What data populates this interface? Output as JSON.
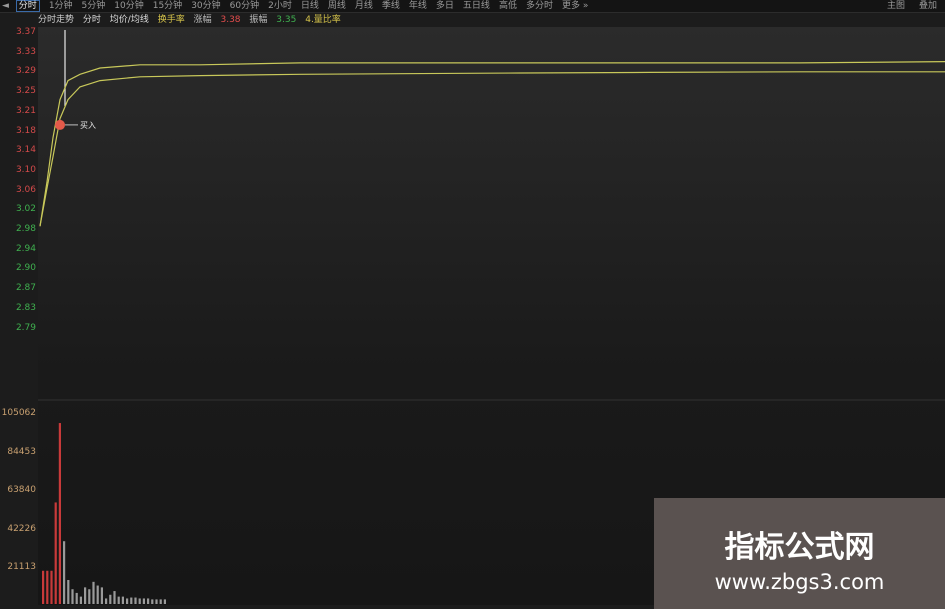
{
  "toolbar": {
    "left_marker": "◄",
    "tabs": [
      "分时",
      "1分钟",
      "5分钟",
      "10分钟",
      "15分钟",
      "30分钟",
      "60分钟",
      "2小时",
      "日线",
      "周线",
      "月线",
      "季线",
      "年线",
      "多日",
      "五日线",
      "高低",
      "多分时",
      "更多 »"
    ],
    "active_tab": 0,
    "right_items": [
      "主图",
      "叠加"
    ]
  },
  "info": {
    "name": "分时走势",
    "item1": "分时",
    "item2": "均价/均线",
    "item3": "换手率",
    "label_rise": "涨幅",
    "value_rise": "3.38",
    "label_amp": "振幅",
    "value_amp": "3.35",
    "item4": "4.量比率"
  },
  "price_axis": {
    "ticks": [
      "3.37",
      "3.33",
      "3.29",
      "3.25",
      "3.21",
      "3.18",
      "3.14",
      "3.10",
      "3.06",
      "3.02",
      "2.98",
      "2.94",
      "2.90",
      "2.87",
      "2.83",
      "2.79"
    ],
    "up_color": "#d24a4a",
    "down_color": "#3fb04f"
  },
  "volume_axis": {
    "ticks": [
      "105062",
      "84453",
      "63840",
      "42226",
      "21113"
    ],
    "color": "#c8a070"
  },
  "chart_data": {
    "type": "line",
    "price": {
      "top": 3.37,
      "bottom": 2.79
    },
    "series": [
      {
        "color": "#c8c85a",
        "values": [
          3.06,
          3.13,
          3.2,
          3.26,
          3.29,
          3.3,
          3.31,
          3.315,
          3.315,
          3.318,
          3.318,
          3.318,
          3.318,
          3.318,
          3.32
        ]
      },
      {
        "color": "#c8c85a",
        "values": [
          3.06,
          3.12,
          3.17,
          3.23,
          3.26,
          3.28,
          3.29,
          3.296,
          3.298,
          3.3,
          3.301,
          3.302,
          3.303,
          3.304,
          3.304
        ]
      }
    ],
    "marker_value": 3.22,
    "marker_label": "买入",
    "volume": {
      "max": 105062,
      "bars": [
        18000,
        18000,
        18000,
        55000,
        98000,
        34000,
        13000,
        8000,
        6000,
        4000,
        9000,
        8000,
        12000,
        10000,
        9000,
        3000,
        5000,
        7000,
        4000,
        4000,
        3000,
        3500,
        3500,
        3000,
        3000,
        3000,
        2500,
        2500,
        2500,
        2500
      ],
      "colors": [
        "red",
        "red",
        "red",
        "red",
        "red",
        "grey",
        "grey",
        "grey",
        "grey",
        "grey",
        "grey",
        "grey",
        "grey",
        "grey",
        "grey",
        "grey",
        "grey",
        "grey",
        "grey",
        "grey",
        "grey",
        "grey",
        "grey",
        "grey",
        "grey",
        "grey",
        "grey",
        "grey",
        "grey",
        "grey"
      ]
    }
  },
  "watermark": {
    "line1": "指标公式网",
    "line2": "www.zbgs3.com"
  }
}
